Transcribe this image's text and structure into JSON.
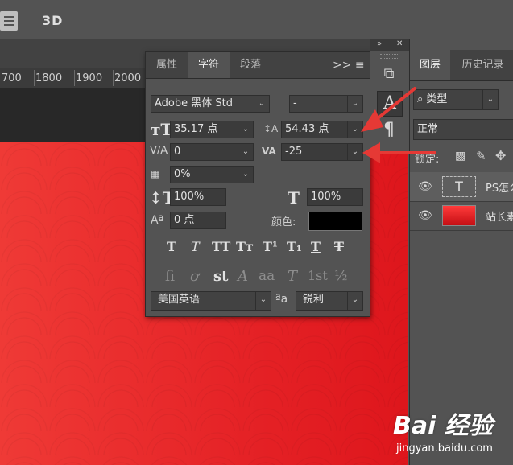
{
  "topbar": {
    "btn_3d": "3D"
  },
  "ruler": {
    "marks": [
      "700",
      "1800",
      "1900",
      "2000"
    ]
  },
  "char_panel": {
    "tabs": [
      "属性",
      "字符",
      "段落"
    ],
    "menu_glyph": ">> ≡",
    "font_family": "Adobe 黑体 Std",
    "font_style": "-",
    "font_size": "35.17 点",
    "leading": "54.43 点",
    "kerning": "0",
    "tracking": "-25",
    "tsume": "0%",
    "vertical_scale": "100%",
    "horizontal_scale": "100%",
    "baseline_shift": "0 点",
    "color_label": "颜色:",
    "color_value": "#000000",
    "style_buttons": [
      "T",
      "T",
      "TT",
      "Tт",
      "T¹",
      "T₁",
      "T",
      "T"
    ],
    "opentype_buttons": [
      "fi",
      "ơ",
      "st",
      "A",
      "aa",
      "T",
      "1st",
      "½"
    ],
    "language": "美国英语",
    "aa_label": "ªa",
    "antialias": "锐利"
  },
  "icon_strip": {
    "collapse": "»",
    "close": "✕",
    "icons": [
      "cube-icon",
      "character-icon",
      "paragraph-icon"
    ]
  },
  "layers_panel": {
    "tabs": [
      "图层",
      "历史记录"
    ],
    "filter_kind": "类型",
    "blend_mode": "正常",
    "lock_label": "锁定:",
    "layers": [
      {
        "name": "PS怎么",
        "kind": "text",
        "thumb": "T"
      },
      {
        "name": "站长素",
        "kind": "image",
        "thumb": ""
      }
    ]
  },
  "watermark": {
    "brand": "Bai 经验",
    "url": "jingyan.baidu.com"
  },
  "colors": {
    "panel": "#535353",
    "panel_dark": "#424242",
    "canvas_red": "#e8232a",
    "arrow_red": "#e53935"
  }
}
